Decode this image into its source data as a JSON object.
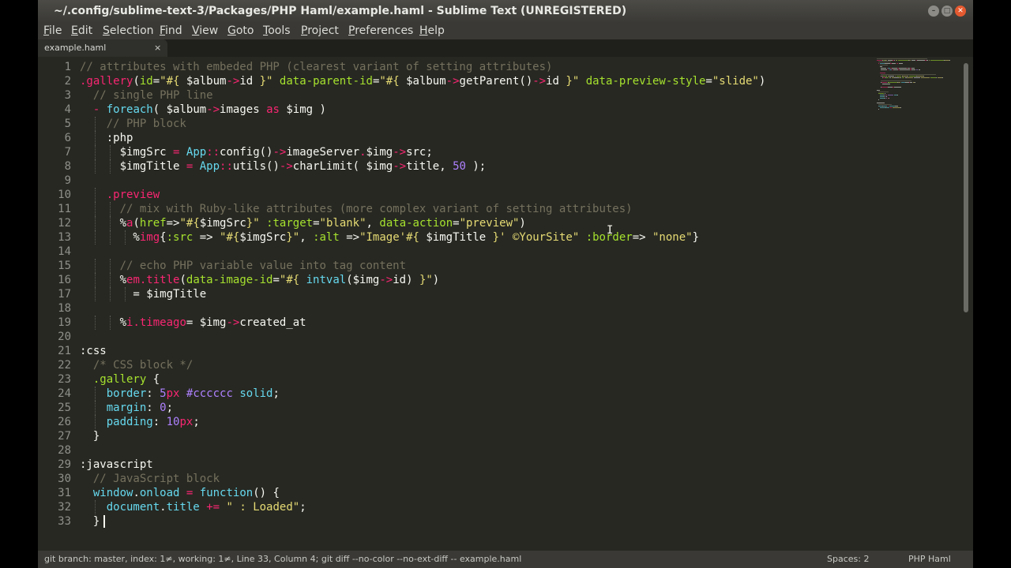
{
  "window": {
    "title": "~/.config/sublime-text-3/Packages/PHP Haml/example.haml - Sublime Text (UNREGISTERED)",
    "buttons": {
      "minimize": "–",
      "maximize": "□",
      "close": "✕"
    }
  },
  "menu": [
    "File",
    "Edit",
    "Selection",
    "Find",
    "View",
    "Goto",
    "Tools",
    "Project",
    "Preferences",
    "Help"
  ],
  "tab": {
    "label": "example.haml",
    "close": "×"
  },
  "colors": {
    "background": "#272822",
    "comment": "#75715e",
    "keyword": "#f92672",
    "string": "#e6db74",
    "function": "#a6e22e",
    "number": "#ae81ff",
    "support": "#66d9ef",
    "plain": "#f8f8f2"
  },
  "editor": {
    "cursor": {
      "line": 33,
      "column": 4
    },
    "lines": [
      [
        [
          "c",
          "// attributes with embeded PHP (clearest variant of setting attributes)"
        ]
      ],
      [
        [
          "k",
          ".gallery"
        ],
        [
          "p",
          "("
        ],
        [
          "f",
          "id"
        ],
        [
          "p",
          "="
        ],
        [
          "s",
          "\"#{ "
        ],
        [
          "p",
          "$album"
        ],
        [
          "k",
          "->"
        ],
        [
          "p",
          "id "
        ],
        [
          "s",
          "}\""
        ],
        [
          "p",
          " "
        ],
        [
          "f",
          "data-parent-id"
        ],
        [
          "p",
          "="
        ],
        [
          "s",
          "\"#{ "
        ],
        [
          "p",
          "$album"
        ],
        [
          "k",
          "->"
        ],
        [
          "p",
          "getParent()"
        ],
        [
          "k",
          "->"
        ],
        [
          "p",
          "id "
        ],
        [
          "s",
          "}\""
        ],
        [
          "p",
          " "
        ],
        [
          "f",
          "data-preview-style"
        ],
        [
          "p",
          "="
        ],
        [
          "s",
          "\"slide\""
        ],
        [
          "p",
          ")"
        ]
      ],
      [
        [
          "p",
          "  "
        ],
        [
          "c",
          "// single PHP line"
        ]
      ],
      [
        [
          "p",
          "  "
        ],
        [
          "k",
          "-"
        ],
        [
          "p",
          " "
        ],
        [
          "u",
          "foreach"
        ],
        [
          "p",
          "( $album"
        ],
        [
          "k",
          "->"
        ],
        [
          "p",
          "images "
        ],
        [
          "k",
          "as"
        ],
        [
          "p",
          " $img )"
        ]
      ],
      [
        [
          "p",
          "    "
        ],
        [
          "c",
          "// PHP block"
        ]
      ],
      [
        [
          "p",
          "    :php"
        ]
      ],
      [
        [
          "p",
          "      $imgSrc "
        ],
        [
          "k",
          "="
        ],
        [
          "p",
          " "
        ],
        [
          "u",
          "App"
        ],
        [
          "k",
          "::"
        ],
        [
          "p",
          "config()"
        ],
        [
          "k",
          "->"
        ],
        [
          "p",
          "imageServer"
        ],
        [
          "k",
          "."
        ],
        [
          "p",
          "$img"
        ],
        [
          "k",
          "->"
        ],
        [
          "p",
          "src;"
        ]
      ],
      [
        [
          "p",
          "      $imgTitle "
        ],
        [
          "k",
          "="
        ],
        [
          "p",
          " "
        ],
        [
          "u",
          "App"
        ],
        [
          "k",
          "::"
        ],
        [
          "p",
          "utils()"
        ],
        [
          "k",
          "->"
        ],
        [
          "p",
          "charLimit( $img"
        ],
        [
          "k",
          "->"
        ],
        [
          "p",
          "title, "
        ],
        [
          "n",
          "50"
        ],
        [
          "p",
          " );"
        ]
      ],
      [
        [
          "p",
          ""
        ]
      ],
      [
        [
          "p",
          "    "
        ],
        [
          "k",
          ".preview"
        ]
      ],
      [
        [
          "p",
          "      "
        ],
        [
          "c",
          "// mix with Ruby-like attributes (more complex variant of setting attributes)"
        ]
      ],
      [
        [
          "p",
          "      %"
        ],
        [
          "k",
          "a"
        ],
        [
          "p",
          "("
        ],
        [
          "f",
          "href"
        ],
        [
          "p",
          "=>"
        ],
        [
          "s",
          "\"#{"
        ],
        [
          "p",
          "$imgSrc"
        ],
        [
          "s",
          "}\""
        ],
        [
          "p",
          " "
        ],
        [
          "f",
          ":target"
        ],
        [
          "p",
          "="
        ],
        [
          "s",
          "\"blank\""
        ],
        [
          "p",
          ", "
        ],
        [
          "f",
          "data-action"
        ],
        [
          "p",
          "="
        ],
        [
          "s",
          "\"preview\""
        ],
        [
          "p",
          ")"
        ]
      ],
      [
        [
          "p",
          "        %"
        ],
        [
          "k",
          "img"
        ],
        [
          "p",
          "{"
        ],
        [
          "f",
          ":src"
        ],
        [
          "p",
          " => "
        ],
        [
          "s",
          "\"#{"
        ],
        [
          "p",
          "$imgSrc"
        ],
        [
          "s",
          "}\""
        ],
        [
          "p",
          ", "
        ],
        [
          "f",
          ":alt"
        ],
        [
          "p",
          " =>"
        ],
        [
          "s",
          "\"Image'#{ "
        ],
        [
          "p",
          "$imgTitle "
        ],
        [
          "s",
          "}' ©YourSite\""
        ],
        [
          "p",
          " "
        ],
        [
          "f",
          ":border"
        ],
        [
          "p",
          "=> "
        ],
        [
          "s",
          "\"none\""
        ],
        [
          "p",
          "}"
        ]
      ],
      [
        [
          "p",
          ""
        ]
      ],
      [
        [
          "p",
          "      "
        ],
        [
          "c",
          "// echo PHP variable value into tag content"
        ]
      ],
      [
        [
          "p",
          "      %"
        ],
        [
          "k",
          "em"
        ],
        [
          "k",
          ".title"
        ],
        [
          "p",
          "("
        ],
        [
          "f",
          "data-image-id"
        ],
        [
          "p",
          "="
        ],
        [
          "s",
          "\"#{ "
        ],
        [
          "u",
          "intval"
        ],
        [
          "p",
          "($img"
        ],
        [
          "k",
          "->"
        ],
        [
          "p",
          "id) "
        ],
        [
          "s",
          "}\""
        ],
        [
          "p",
          ")"
        ]
      ],
      [
        [
          "p",
          "        = $imgTitle"
        ]
      ],
      [
        [
          "p",
          ""
        ]
      ],
      [
        [
          "p",
          "      %"
        ],
        [
          "k",
          "i"
        ],
        [
          "k",
          ".timeago"
        ],
        [
          "p",
          "= $img"
        ],
        [
          "k",
          "->"
        ],
        [
          "p",
          "created_at"
        ]
      ],
      [
        [
          "p",
          ""
        ]
      ],
      [
        [
          "p",
          ":css"
        ]
      ],
      [
        [
          "p",
          "  "
        ],
        [
          "c",
          "/* CSS block */"
        ]
      ],
      [
        [
          "p",
          "  "
        ],
        [
          "f",
          ".gallery"
        ],
        [
          "p",
          " {"
        ]
      ],
      [
        [
          "p",
          "    "
        ],
        [
          "u",
          "border"
        ],
        [
          "p",
          ": "
        ],
        [
          "n",
          "5"
        ],
        [
          "k",
          "px"
        ],
        [
          "p",
          " "
        ],
        [
          "n",
          "#cccccc"
        ],
        [
          "p",
          " "
        ],
        [
          "u",
          "solid"
        ],
        [
          "p",
          ";"
        ]
      ],
      [
        [
          "p",
          "    "
        ],
        [
          "u",
          "margin"
        ],
        [
          "p",
          ": "
        ],
        [
          "n",
          "0"
        ],
        [
          "p",
          ";"
        ]
      ],
      [
        [
          "p",
          "    "
        ],
        [
          "u",
          "padding"
        ],
        [
          "p",
          ": "
        ],
        [
          "n",
          "10"
        ],
        [
          "k",
          "px"
        ],
        [
          "p",
          ";"
        ]
      ],
      [
        [
          "p",
          "  }"
        ]
      ],
      [
        [
          "p",
          ""
        ]
      ],
      [
        [
          "p",
          ":javascript"
        ]
      ],
      [
        [
          "p",
          "  "
        ],
        [
          "c",
          "// JavaScript block"
        ]
      ],
      [
        [
          "p",
          "  "
        ],
        [
          "u",
          "window"
        ],
        [
          "p",
          "."
        ],
        [
          "u",
          "onload"
        ],
        [
          "p",
          " "
        ],
        [
          "k",
          "="
        ],
        [
          "p",
          " "
        ],
        [
          "u",
          "function"
        ],
        [
          "p",
          "() {"
        ]
      ],
      [
        [
          "p",
          "    "
        ],
        [
          "u",
          "document"
        ],
        [
          "p",
          "."
        ],
        [
          "u",
          "title"
        ],
        [
          "p",
          " "
        ],
        [
          "k",
          "+="
        ],
        [
          "p",
          " "
        ],
        [
          "s",
          "\" : Loaded\""
        ],
        [
          "p",
          ";"
        ]
      ],
      [
        [
          "p",
          "  }"
        ]
      ]
    ]
  },
  "status": {
    "left": "git branch: master, index: 1≠, working: 1≠, Line 33, Column 4; git diff --no-color --no-ext-diff -- example.haml",
    "spaces": "Spaces: 2",
    "syntax": "PHP Haml"
  }
}
